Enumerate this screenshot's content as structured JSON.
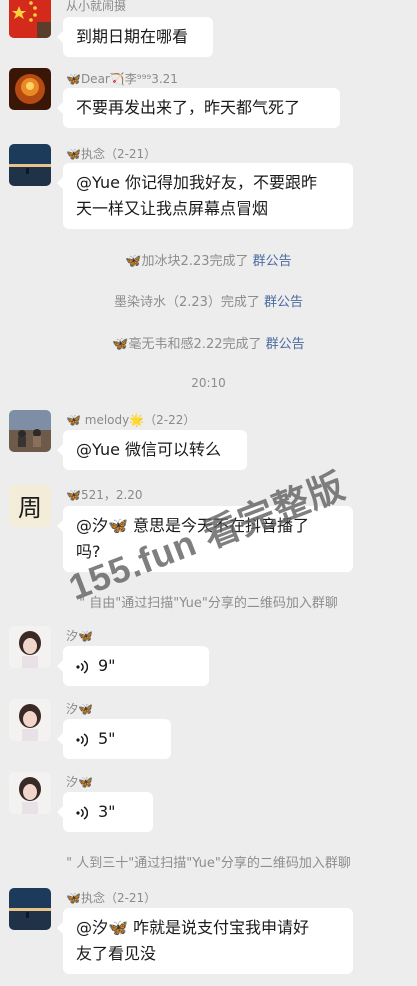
{
  "top_message": {
    "sender": "从小就闹摄",
    "text": "到期日期在哪看"
  },
  "messages": [
    {
      "sender": "🦋Dear🏹李⁹⁹⁹3.21",
      "text": "不要再发出来了，昨天都气死了"
    },
    {
      "sender": "🦋执念（2-21）",
      "text_line1": "@Yue 你记得加我好友，不要跟昨",
      "text_line2": "天一样又让我点屏幕点冒烟"
    },
    {
      "sender": "🦋 melody🌟（2-22）",
      "text": "@Yue 微信可以转么"
    },
    {
      "sender": "🦋521，2.20",
      "text_line1": "@汐🦋 意思是今天不在抖音播了",
      "text_line2": "吗?"
    },
    {
      "sender": "汐🦋",
      "voice": "9\""
    },
    {
      "sender": "汐🦋",
      "voice": "5\""
    },
    {
      "sender": "汐🦋",
      "voice": "3\""
    },
    {
      "sender": "🦋执念（2-21）",
      "text_line1": "@汐🦋 咋就是说支付宝我申请好",
      "text_line2": "友了看见没"
    }
  ],
  "system": {
    "n1": {
      "main": "🦋加冰块2.23完成了 ",
      "link": "群公告"
    },
    "n2": {
      "main": "墨染诗水（2.23）完成了 ",
      "link": "群公告"
    },
    "n3": {
      "main": "🦋毫无韦和感2.22完成了 ",
      "link": "群公告"
    },
    "time": "20:10",
    "join1": "\" 自由\"通过扫描\"Yue\"分享的二维码加入群聊",
    "join2": "\" 人到三十\"通过扫描\"Yue\"分享的二维码加入群聊"
  },
  "watermark": "155.fun 看完整版",
  "icons": {
    "voice": "voice-wave-icon"
  }
}
